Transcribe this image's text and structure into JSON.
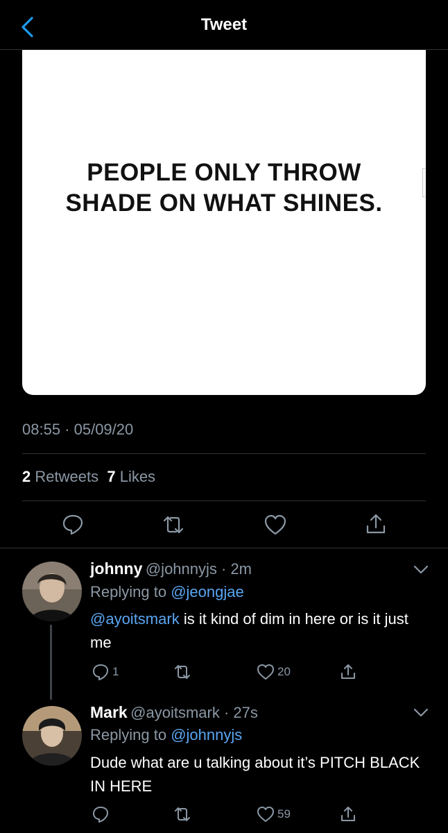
{
  "nav": {
    "title": "Tweet",
    "back_icon": "chevron-left-icon"
  },
  "media": {
    "quote_line1": "PEOPLE ONLY THROW",
    "quote_line2": "SHADE ON WHAT SHINES."
  },
  "tweet": {
    "timestamp": "08:55 · 05/09/20",
    "retweets_count": "2",
    "retweets_label": "Retweets",
    "likes_count": "7",
    "likes_label": "Likes",
    "actions": [
      "reply-icon",
      "retweet-icon",
      "like-icon",
      "share-icon"
    ]
  },
  "replies": [
    {
      "name": "johnny",
      "handle": "@johnnyjs · 2m",
      "replying_prefix": "Replying to",
      "replying_to": "@jeongjae",
      "mention": "@ayoitsmark",
      "text_rest": " is it kind of dim in here or is it just me",
      "reply_count": "1",
      "retweet_count": "",
      "like_count": "20"
    },
    {
      "name": "Mark",
      "handle": "@ayoitsmark · 27s",
      "replying_prefix": "Replying to",
      "replying_to": "@johnnyjs",
      "text": "Dude what are u talking about it’s PITCH BLACK IN HERE",
      "reply_count": "",
      "retweet_count": "",
      "like_count": "59"
    }
  ],
  "colors": {
    "background": "#000000",
    "muted": "#8b98a5",
    "link": "#5aa6f2",
    "divider": "#2f3336"
  }
}
